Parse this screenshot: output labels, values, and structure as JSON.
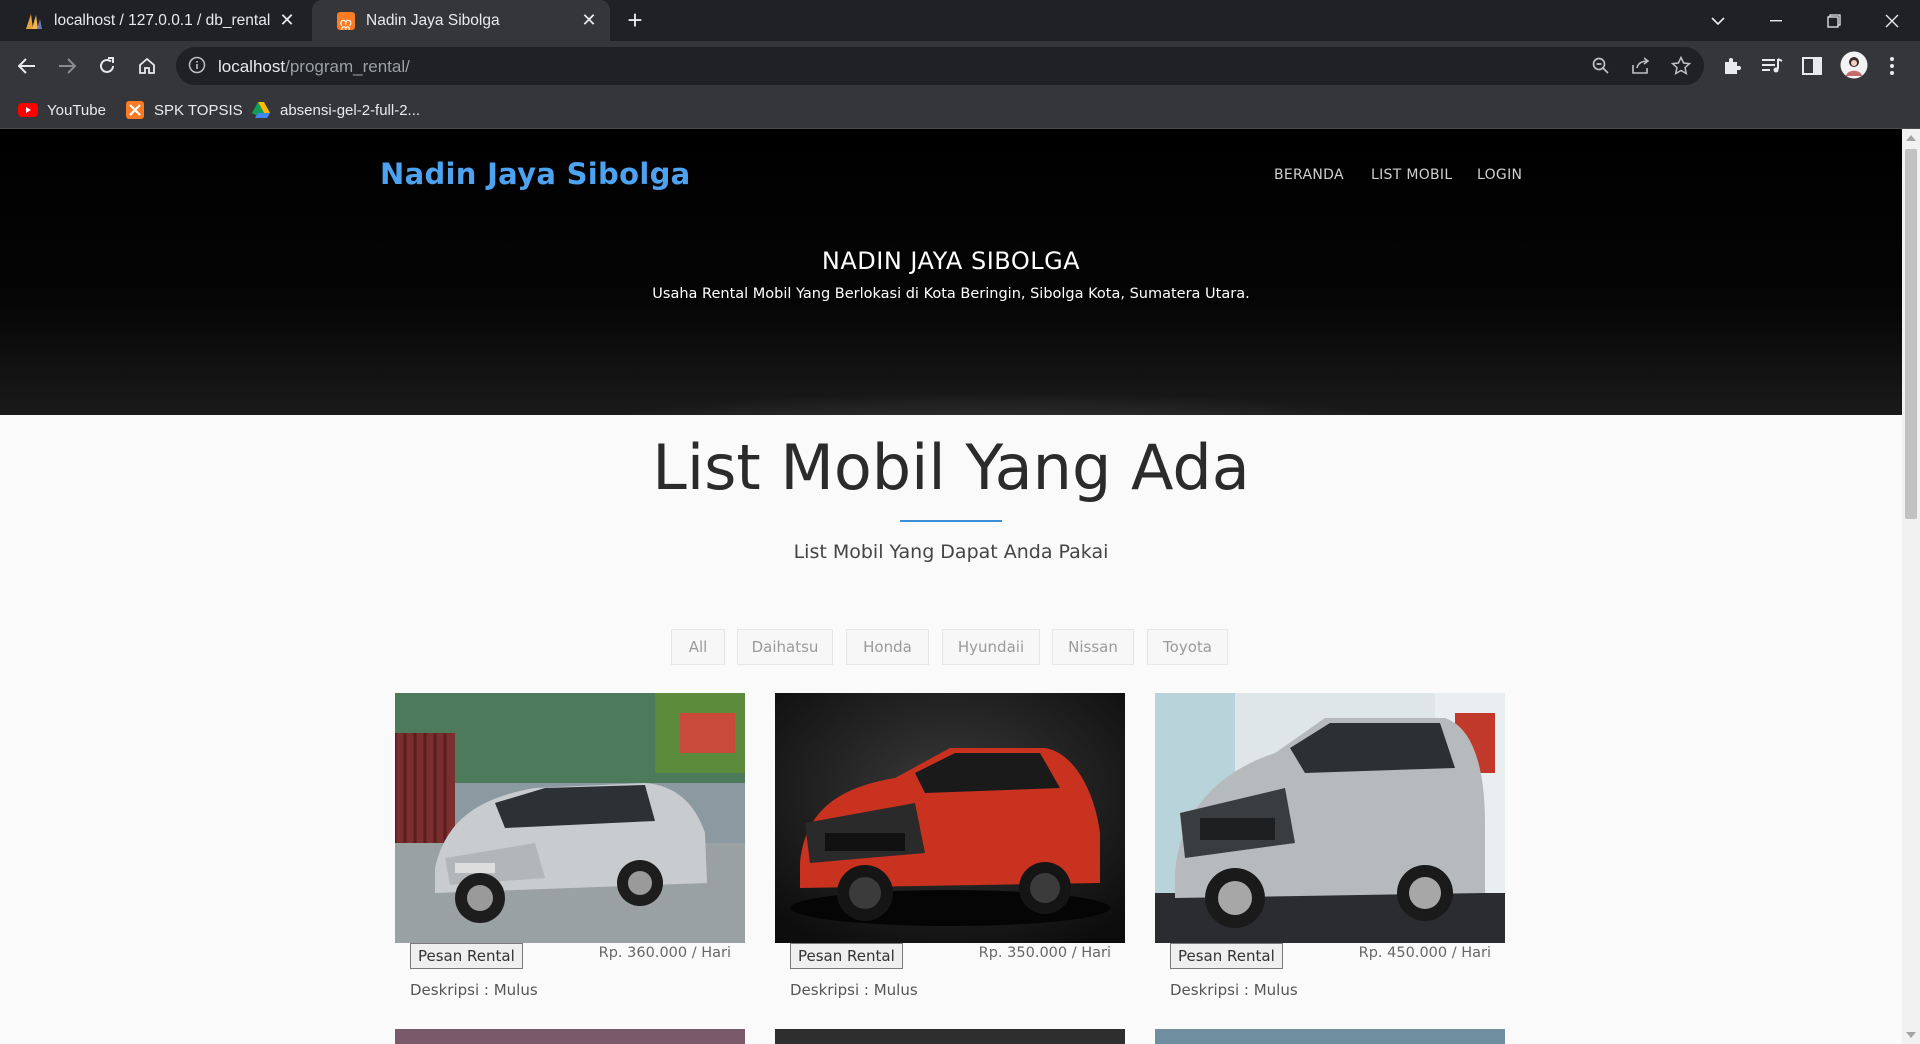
{
  "browser": {
    "tabs": [
      {
        "title": "localhost / 127.0.0.1 / db_rental |",
        "active": false
      },
      {
        "title": "Nadin Jaya Sibolga",
        "active": true
      }
    ],
    "url_host": "localhost",
    "url_path": "/program_rental/",
    "bookmarks": [
      {
        "label": "YouTube",
        "icon": "youtube-icon"
      },
      {
        "label": "SPK TOPSIS",
        "icon": "xampp-icon"
      },
      {
        "label": "absensi-gel-2-full-2...",
        "icon": "google-drive-icon"
      }
    ]
  },
  "site": {
    "brand": "Nadin Jaya Sibolga",
    "menu": [
      "BERANDA",
      "LIST MOBIL",
      "LOGIN"
    ],
    "hero_title": "NADIN JAYA SIBOLGA",
    "hero_subtitle": "Usaha Rental Mobil Yang Berlokasi di Kota Beringin, Sibolga Kota, Sumatera Utara.",
    "brand_color": "#4da3f0"
  },
  "section": {
    "title": "List Mobil Yang Ada",
    "subtitle": "List Mobil Yang Dapat Anda Pakai",
    "filters": [
      "All",
      "Daihatsu",
      "Honda",
      "Hyundaii",
      "Nissan",
      "Toyota"
    ]
  },
  "cars": [
    {
      "button": "Pesan Rental",
      "price": "Rp. 360.000 / Hari",
      "desc": "Deskripsi : Mulus"
    },
    {
      "button": "Pesan Rental",
      "price": "Rp. 350.000 / Hari",
      "desc": "Deskripsi : Mulus"
    },
    {
      "button": "Pesan Rental",
      "price": "Rp. 450.000 / Hari",
      "desc": "Deskripsi : Mulus"
    }
  ]
}
